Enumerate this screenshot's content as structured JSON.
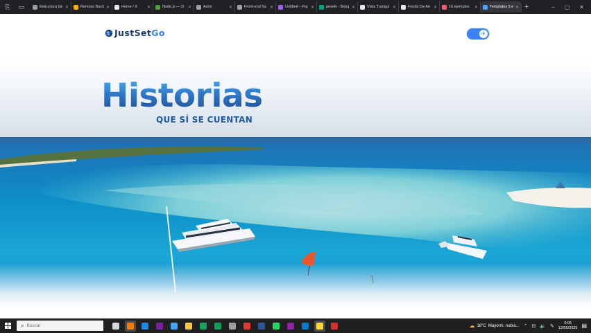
{
  "browser": {
    "tabs": [
      {
        "label": "Estructura bá",
        "color": "#9aa0a6"
      },
      {
        "label": "Remove Back",
        "color": "#f5b400"
      },
      {
        "label": "Home / X",
        "color": "#e8eaed"
      },
      {
        "label": "Node.js — D",
        "color": "#539e43"
      },
      {
        "label": "Astro",
        "color": "#9aa0a6"
      },
      {
        "label": "Front-end fra",
        "color": "#9aa0a6"
      },
      {
        "label": "Untitled – Fig",
        "color": "#a259ff"
      },
      {
        "label": "pexels - Búsq",
        "color": "#05a081"
      },
      {
        "label": "Vista Tranqui",
        "color": "#e8eaed"
      },
      {
        "label": "Fondo De An",
        "color": "#e8eaed"
      },
      {
        "label": "16 ejemplos",
        "color": "#ff5a5f"
      },
      {
        "label": "Templates 5 e",
        "color": "#4da3ff",
        "active": true
      }
    ],
    "new_tab": "+",
    "controls": {
      "minimize": "–",
      "maximize": "▢",
      "close": "✕"
    }
  },
  "site": {
    "logo": {
      "main": "JustSet",
      "accent": "Go"
    },
    "toggle_icon": "airplane-icon"
  },
  "hero": {
    "title": "Historias",
    "subtitle": "QUE SÍ SE CUENTAN"
  },
  "taskbar": {
    "search_placeholder": "Buscar",
    "apps": [
      {
        "name": "task-view",
        "color": "#cfd8dc"
      },
      {
        "name": "app-orange",
        "color": "#f57c00",
        "highlighted": true
      },
      {
        "name": "edge",
        "color": "#1e88e5"
      },
      {
        "name": "terminal",
        "color": "#7b1fa2"
      },
      {
        "name": "store",
        "color": "#42a5f5"
      },
      {
        "name": "explorer",
        "color": "#f9c846"
      },
      {
        "name": "chrome",
        "color": "#1aa260"
      },
      {
        "name": "edge-2",
        "color": "#0f9d58"
      },
      {
        "name": "cmd",
        "color": "#9e9e9e"
      },
      {
        "name": "opera",
        "color": "#e53935"
      },
      {
        "name": "word",
        "color": "#2b579a"
      },
      {
        "name": "whatsapp",
        "color": "#25d366"
      },
      {
        "name": "vpn",
        "color": "#8e24aa"
      },
      {
        "name": "vscode",
        "color": "#007acc"
      },
      {
        "name": "notepad",
        "color": "#fdd835",
        "highlighted": true
      },
      {
        "name": "acrobat",
        "color": "#d32f2f"
      }
    ],
    "weather": {
      "temp": "18°C",
      "desc": "Mayorm. nubla..."
    },
    "clock": {
      "time": "0:05",
      "date": "12/05/2025"
    }
  }
}
